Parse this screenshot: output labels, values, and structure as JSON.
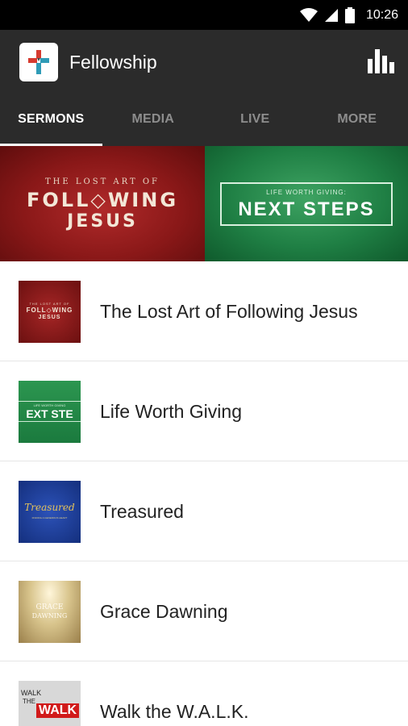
{
  "status_bar": {
    "time": "10:26",
    "icons": [
      "wifi-icon",
      "signal-icon",
      "battery-icon"
    ]
  },
  "app_bar": {
    "title": "Fellowship",
    "logo_icon": "cross-logo-icon",
    "action_icon": "bar-chart-icon"
  },
  "tabs": [
    {
      "label": "SERMONS",
      "active": true
    },
    {
      "label": "MEDIA",
      "active": false
    },
    {
      "label": "LIVE",
      "active": false
    },
    {
      "label": "MORE",
      "active": false
    }
  ],
  "banner": {
    "left": {
      "small": "THE LOST ART OF",
      "big_line1": "FOLL◇WING",
      "big_line2": "JESUS"
    },
    "right": {
      "small": "LIFE WORTH GIVING:",
      "big": "NEXT STEPS"
    }
  },
  "series": [
    {
      "title": "The Lost Art of Following Jesus",
      "thumb_text_top": "THE LOST ART OF",
      "thumb_text_main": "FOLL◇WING",
      "thumb_text_sub": "JESUS"
    },
    {
      "title": "Life Worth Giving",
      "thumb_text_top": "LIFE WORTH GIVING",
      "thumb_text_main": "EXT STE"
    },
    {
      "title": "Treasured",
      "thumb_text_main": "Treasured",
      "thumb_text_sub": "FINDING A GENEROUS HEART"
    },
    {
      "title": "Grace Dawning",
      "thumb_text_main": "GRACE",
      "thumb_text_sub": "DAWNING"
    },
    {
      "title": "Walk the W.A.L.K.",
      "thumb_text_top": "WALK",
      "thumb_text_mid": "THE",
      "thumb_text_main": "WALK"
    }
  ],
  "colors": {
    "app_bar": "#2b2b2b",
    "status_bar": "#000000",
    "tab_active": "#ffffff",
    "tab_inactive": "#8d8d8d",
    "walk_red": "#d11a1a"
  }
}
